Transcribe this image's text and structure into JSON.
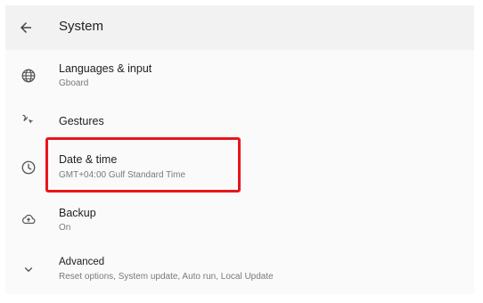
{
  "header": {
    "title": "System"
  },
  "items": [
    {
      "label": "Languages & input",
      "subtitle": "Gboard",
      "icon": "globe-icon"
    },
    {
      "label": "Gestures",
      "subtitle": "",
      "icon": "gestures-icon"
    },
    {
      "label": "Date & time",
      "subtitle": "GMT+04:00 Gulf Standard Time",
      "icon": "clock-icon"
    },
    {
      "label": "Backup",
      "subtitle": "On",
      "icon": "cloud-upload-icon"
    },
    {
      "label": "Advanced",
      "subtitle": "Reset options, System update, Auto run, Local Update",
      "icon": "chevron-down-icon"
    }
  ],
  "colors": {
    "highlight_border": "#e8151b",
    "appbar_bg": "#f2f2f2",
    "text_primary": "#212121",
    "text_secondary": "#7a7a7a"
  }
}
